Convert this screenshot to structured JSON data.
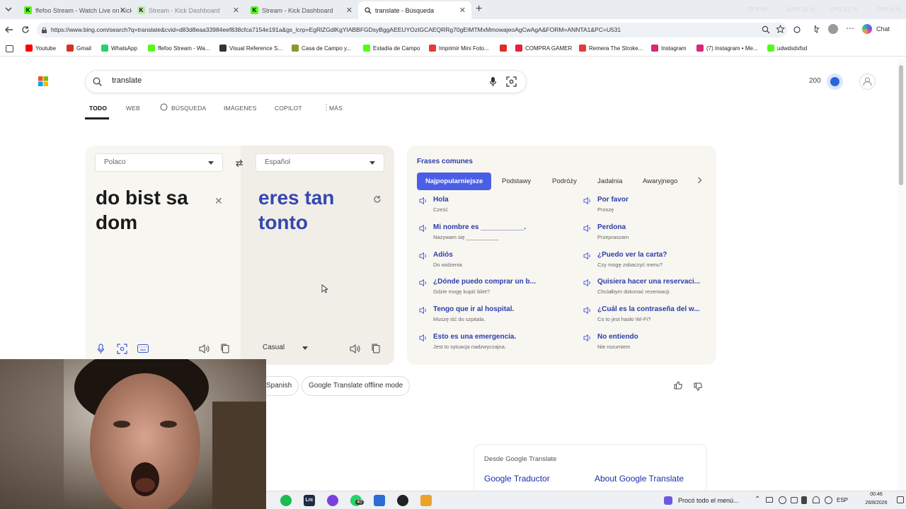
{
  "browser": {
    "tabs": [
      {
        "label": "ffefoo Stream - Watch Live on Kick",
        "active": false
      },
      {
        "label": "Stream - Kick Dashboard",
        "active": false
      },
      {
        "label": "Stream - Kick Dashboard",
        "active": false
      },
      {
        "label": "translate - Búsqueda",
        "active": true
      }
    ],
    "new_tab_label": "+",
    "overlay_stats": {
      "fps": "FPS 60",
      "gpu": "GPU 11 %",
      "cpu": "CPU 21 %",
      "extra": "CPU 0 %"
    },
    "url": "https://www.bing.com/search?q=translate&cvid=d83d8eaa33984eef838cfca7154e191a&gs_lcrp=EgRlZGdlKgYIABBFGDsyBggAEEUYOzIGCAEQRRg70gEIMTMxMmowajeoAgCwAgA&FORM=ANNTA1&PC=U531",
    "chat_label": "Chat",
    "bookmarks": [
      {
        "label": "Youtube",
        "icon": "youtube-icon",
        "color": "#ff0000"
      },
      {
        "label": "Gmail",
        "icon": "gmail-icon",
        "color": "#d93025"
      },
      {
        "label": "WhatsApp",
        "icon": "whatsapp-icon",
        "color": "#25d366"
      },
      {
        "label": "ffefoo Stream - Wa...",
        "icon": "kick-icon",
        "color": "#53fc18"
      },
      {
        "label": "Visual Reference S...",
        "icon": "reference-icon",
        "color": "#333333"
      },
      {
        "label": "Casa de Campo y...",
        "icon": "campo-icon",
        "color": "#8a9a2a"
      },
      {
        "label": "Estadía de Campo",
        "icon": "kick-icon",
        "color": "#53fc18"
      },
      {
        "label": "Imprimir Mini Foto...",
        "icon": "print-icon",
        "color": "#e23b3b"
      },
      {
        "label": "",
        "icon": "gmail-icon",
        "color": "#d93025"
      },
      {
        "label": "COMPRA GAMER",
        "icon": "gamer-icon",
        "color": "#e0223c"
      },
      {
        "label": "Remera The Stroke...",
        "icon": "shirt-icon",
        "color": "#e23b3b"
      },
      {
        "label": "Instagram",
        "icon": "instagram-icon",
        "color": "#d62976"
      },
      {
        "label": "(7) Instagram • Me...",
        "icon": "instagram-icon",
        "color": "#d62976"
      },
      {
        "label": "udwdsdxfsd",
        "icon": "kick-icon",
        "color": "#53fc18"
      }
    ]
  },
  "bing": {
    "query": "translate",
    "points": "200",
    "nav": [
      "TODO",
      "WEB",
      "BÚSQUEDA",
      "IMÁGENES",
      "COPILOT",
      "MÁS"
    ],
    "translator": {
      "source_lang": "Polaco",
      "target_lang": "Español",
      "source_text": "do bist sa dom",
      "target_text": "eres tan tonto",
      "tone": "Casual"
    },
    "phrases": {
      "title": "Frases comunes",
      "tabs": [
        "Najpopularniejsze",
        "Podstawy",
        "Podróży",
        "Jadalnia",
        "Awaryjnego"
      ],
      "items": [
        {
          "es": "Hola",
          "pl": "Cześć"
        },
        {
          "es": "Por favor",
          "pl": "Proszę"
        },
        {
          "es": "Mi nombre es ___________.",
          "pl": "Nazywam się ___________"
        },
        {
          "es": "Perdona",
          "pl": "Przepraszam"
        },
        {
          "es": "Adiós",
          "pl": "Do widzenia"
        },
        {
          "es": "¿Puedo ver la carta?",
          "pl": "Czy mogę zobaczyć menu?"
        },
        {
          "es": "¿Dónde puedo comprar un b...",
          "pl": "Gdzie mogę kupić bilet?"
        },
        {
          "es": "Quisiera hacer una reservaci...",
          "pl": "Chciałbym dokonać rezerwacji."
        },
        {
          "es": "Tengo que ir al hospital.",
          "pl": "Muszę iść do szpitala."
        },
        {
          "es": "¿Cuál es la contraseña del w...",
          "pl": "Co to jest hasło Wi-Fi?"
        },
        {
          "es": "Esto es una emergencia.",
          "pl": "Jest to sytuacja nadzwyczajna."
        },
        {
          "es": "No entiendo",
          "pl": "Nie rozumiem"
        }
      ]
    },
    "related": [
      "Spanish",
      "Google Translate offline mode"
    ],
    "from_google": {
      "header": "Desde Google Translate",
      "links": [
        "Google Traductor",
        "About Google Translate"
      ]
    }
  },
  "taskbar": {
    "notification": "Procó todo el menú...",
    "lang": "ESP",
    "time": "00:46",
    "date": "26/8/2026",
    "whatsapp_badge": "40"
  }
}
